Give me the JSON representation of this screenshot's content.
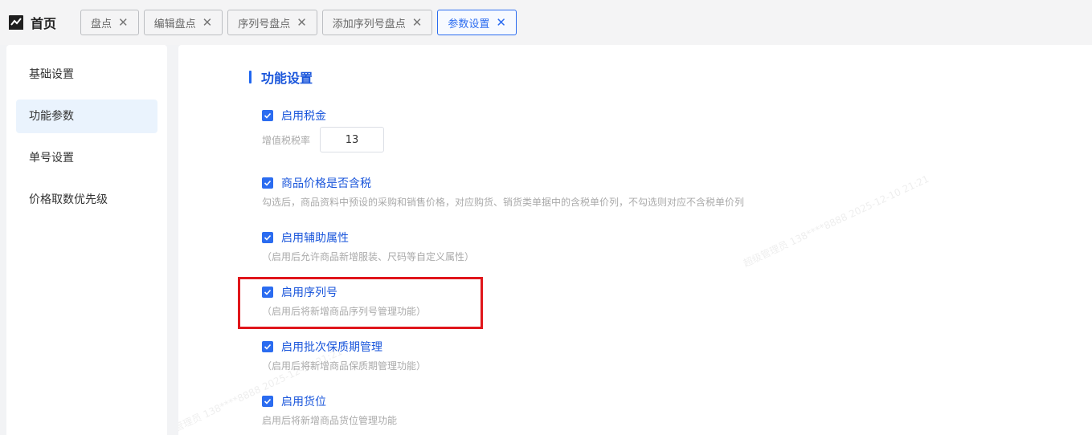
{
  "header": {
    "home_label": "首页",
    "tabs": [
      {
        "label": "盘点",
        "active": false
      },
      {
        "label": "编辑盘点",
        "active": false
      },
      {
        "label": "序列号盘点",
        "active": false
      },
      {
        "label": "添加序列号盘点",
        "active": false
      },
      {
        "label": "参数设置",
        "active": true
      }
    ],
    "close_glyph": "✕"
  },
  "sidebar": {
    "items": [
      {
        "label": "基础设置",
        "active": false
      },
      {
        "label": "功能参数",
        "active": true
      },
      {
        "label": "单号设置",
        "active": false
      },
      {
        "label": "价格取数优先级",
        "active": false
      }
    ]
  },
  "main": {
    "section_title": "功能设置",
    "options": [
      {
        "label": "启用税金",
        "checked": true,
        "vat_label": "增值税税率",
        "vat_value": "13"
      },
      {
        "label": "商品价格是否含税",
        "checked": true,
        "desc": "勾选后，商品资料中预设的采购和销售价格，对应购货、销货类单据中的含税单价列，不勾选则对应不含税单价列"
      },
      {
        "label": "启用辅助属性",
        "checked": true,
        "desc": "（启用后允许商品新增服装、尺码等自定义属性）"
      },
      {
        "label": "启用序列号",
        "checked": true,
        "desc": "（启用后将新增商品序列号管理功能）"
      },
      {
        "label": "启用批次保质期管理",
        "checked": true,
        "desc": "（启用后将新增商品保质期管理功能）"
      },
      {
        "label": "启用货位",
        "checked": true,
        "desc": "启用后将新增商品货位管理功能"
      }
    ]
  },
  "watermark": {
    "text": "超级管理员 138****8888 2025-12-10 21:21"
  },
  "colors": {
    "accent": "#2b6cf0",
    "highlight_border": "#e0161b"
  }
}
